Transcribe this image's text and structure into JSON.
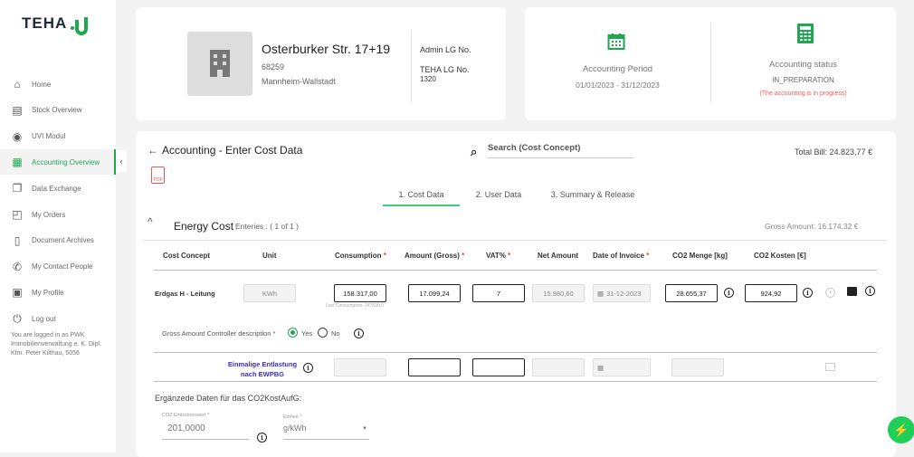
{
  "logo": "TEHA",
  "sidebar": {
    "items": [
      {
        "label": "Home",
        "icon": "home-icon"
      },
      {
        "label": "Stock Overview",
        "icon": "clipboard-icon"
      },
      {
        "label": "UVI Modul",
        "icon": "uvi-icon"
      },
      {
        "label": "Accounting Overview",
        "icon": "calculator-icon"
      },
      {
        "label": "Data Exchange",
        "icon": "copy-icon"
      },
      {
        "label": "My Orders",
        "icon": "bag-icon"
      },
      {
        "label": "Document Archives",
        "icon": "document-icon"
      },
      {
        "label": "My Contact People",
        "icon": "phone-icon"
      },
      {
        "label": "My Profile",
        "icon": "profile-icon"
      },
      {
        "label": "Log out",
        "icon": "power-icon"
      }
    ],
    "logged_in": "You are logged in as PWK Immobilienverwaltung e. K. Dipl. Kfm. Peter Kilthau, 5056"
  },
  "property": {
    "street": "Osterburker Str. 17+19",
    "zip": "68259",
    "city": "Mannheim-Wallstadt",
    "admin_label": "Admin LG No.",
    "teha_label": "TEHA LG No.",
    "teha_no": "1320"
  },
  "period": {
    "label": "Accounting Period",
    "value": "01/01/2023 - 31/12/2023"
  },
  "status": {
    "label": "Accounting status",
    "value": "IN_PREPARATION",
    "note": "(The accounting is in progress)"
  },
  "main": {
    "title": "Accounting - Enter Cost Data",
    "search_placeholder": "Search (Cost Concept)",
    "total_label": "Total Bill:",
    "total": "24.823,77 €",
    "pdf": "PDF",
    "tabs": [
      "1. Cost Data",
      "2. User Data",
      "3. Summary & Release"
    ],
    "section": {
      "title": "Energy Cost",
      "entries": "Enteries : ( 1 of 1 )",
      "gross_label": "Gross Amount:",
      "gross": "16.174,32 €"
    },
    "columns": [
      "Cost Concept",
      "Unit",
      "Consumption",
      "Amount (Gross)",
      "VAT%",
      "Net Amount",
      "Date of Invoice",
      "CO2 Menge [kg]",
      "CO2 Kosten [€]"
    ],
    "required": "*",
    "row": {
      "concept": "Erdgas H - Leitung",
      "unit": "KWh",
      "consumption": "158.317,00",
      "last_consumption": "Last Consumption: 247690,0",
      "gross": "17.099,24",
      "vat": "7",
      "net": "15.980,60",
      "date": "31-12-2023",
      "co2_menge": "28.655,37",
      "co2_kosten": "924,92"
    },
    "controller": {
      "label": "Gross Amount Controller description *",
      "yes": "Yes",
      "no": "No",
      "selected": "Yes"
    },
    "relief": "Einmalige Entlastung nach EWPBG",
    "co2": {
      "heading": "Ergänzede Daten für das CO2KostAufG:",
      "emission_label": "CO2 Emissionswert *",
      "emission_value": "201,0000",
      "unit_label": "Einheit *",
      "unit_value": "g/kWh"
    }
  },
  "colors": {
    "accent": "#1fa84f",
    "required": "#e44",
    "link": "#3a2bd6"
  }
}
